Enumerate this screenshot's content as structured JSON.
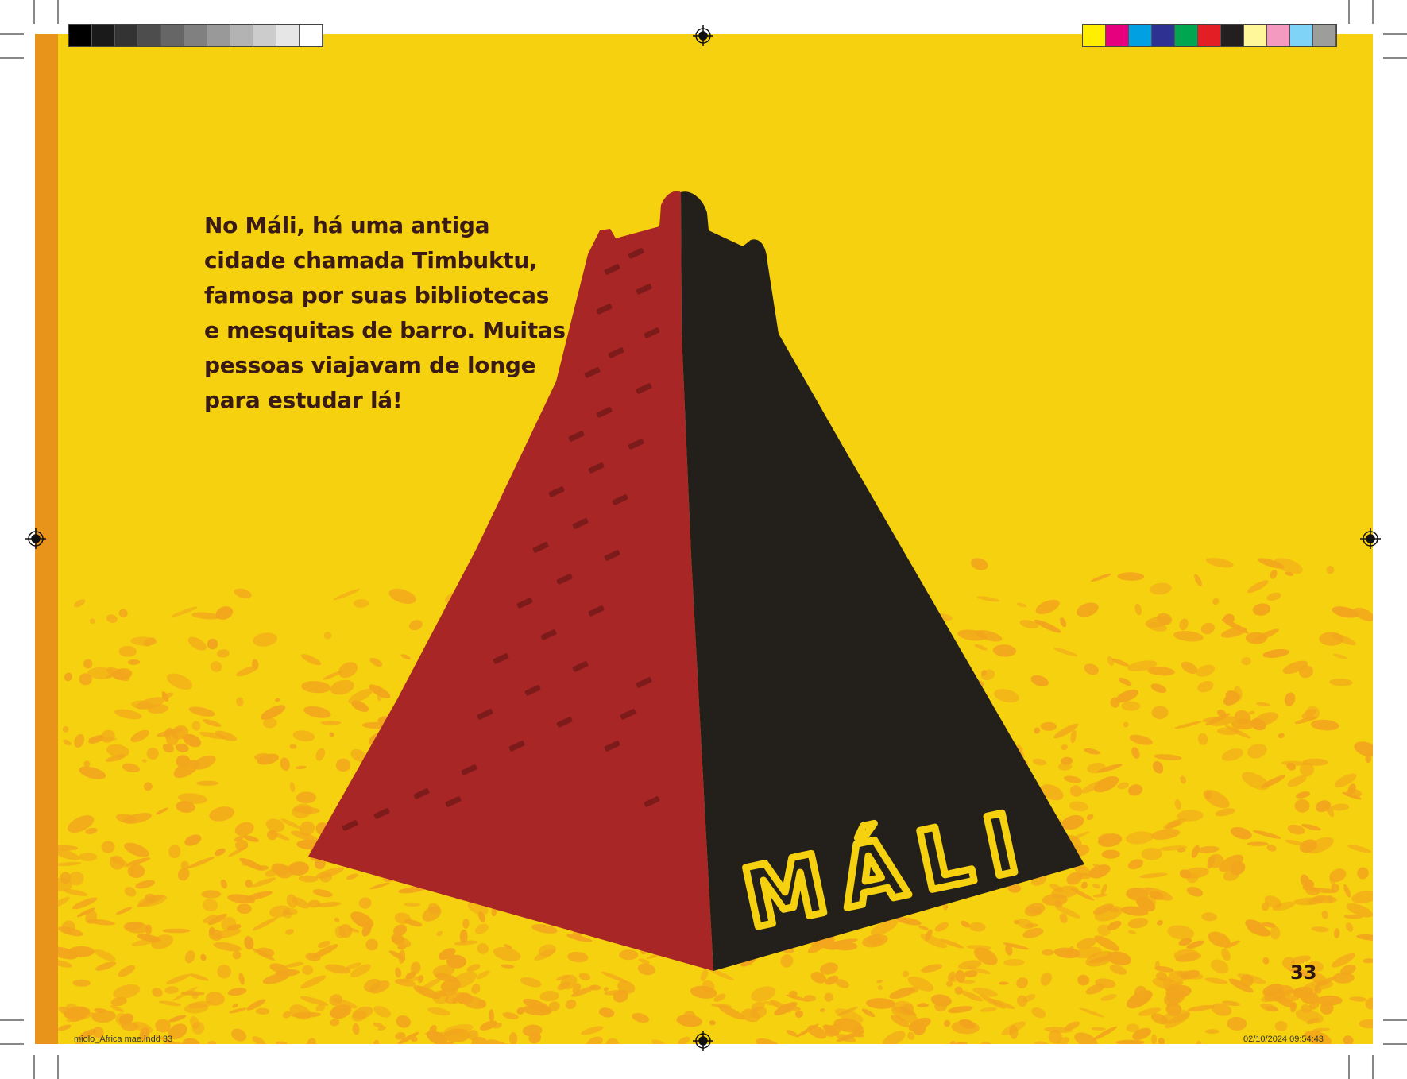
{
  "page": {
    "body_lines": [
      "No Máli, há uma antiga",
      "cidade chamada Timbuktu,",
      "famosa por suas bibliotecas",
      "e mesquitas de barro. Muitas",
      "pessoas viajavam de longe",
      "para estudar lá!"
    ],
    "title": "MÁLI",
    "page_number": "33"
  },
  "print_marks": {
    "slug_file": "miolo_Africa mae.indd   33",
    "slug_date": "02/10/2024   09:54:43",
    "gray_swatches": [
      "#000000",
      "#1a1a1a",
      "#333333",
      "#4d4d4d",
      "#666666",
      "#808080",
      "#999999",
      "#b3b3b3",
      "#cccccc",
      "#e6e6e6",
      "#ffffff"
    ],
    "color_swatches": [
      "#ffee00",
      "#e6007e",
      "#00a0e3",
      "#2e3192",
      "#00a650",
      "#e31e24",
      "#231f20",
      "#fff799",
      "#f49ac1",
      "#7fd3f7",
      "#9d9d9c"
    ]
  },
  "colors": {
    "background": "#f6d10f",
    "sand_texture": "#f2a51d",
    "pyramid_red": "#a82626",
    "pyramid_dark": "#231f1a",
    "title_yellow": "#f6d10f",
    "text": "#3a1a14"
  }
}
